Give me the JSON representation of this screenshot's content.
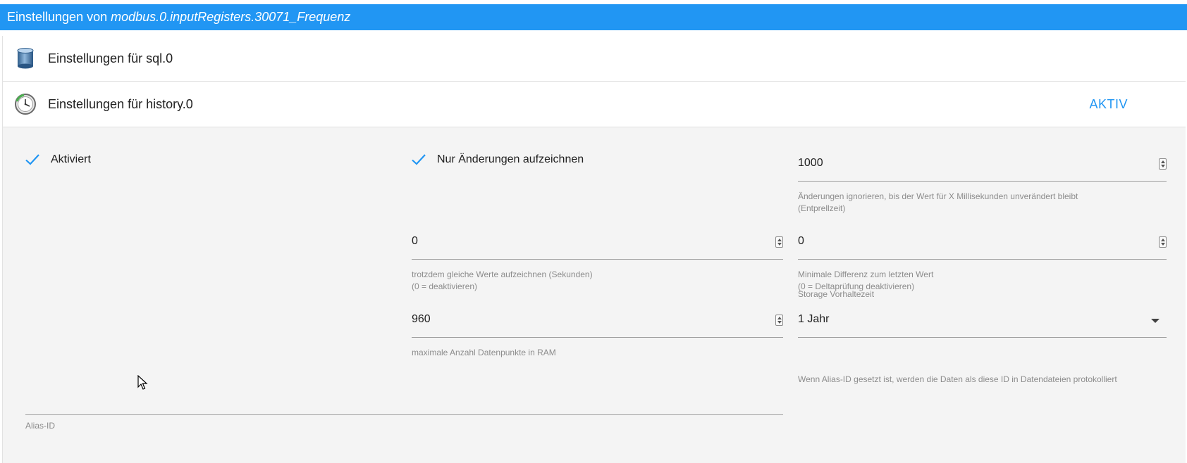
{
  "window": {
    "title_prefix": "Einstellungen von ",
    "object_id": "modbus.0.inputRegisters.30071_Frequenz"
  },
  "adapters": [
    {
      "label": "Einstellungen für sql.0",
      "icon": "database-icon",
      "status": ""
    },
    {
      "label": "Einstellungen für history.0",
      "icon": "clock-icon",
      "status": "AKTIV"
    }
  ],
  "settings": {
    "enabled": {
      "label": "Aktiviert",
      "checked": true
    },
    "changes_only": {
      "label": "Nur Änderungen aufzeichnen",
      "checked": true
    },
    "debounce": {
      "value": "1000",
      "helper": "Änderungen ignorieren, bis der Wert für X Millisekunden unverändert bleibt\n(Entprellzeit)"
    },
    "change_interval": {
      "value": "0",
      "helper": "trotzdem gleiche Werte aufzeichnen (Sekunden)\n(0 = deaktivieren)"
    },
    "min_difference": {
      "value": "0",
      "helper": "Minimale Differenz zum letzten Wert\n(0 = Deltaprüfung deaktivieren)"
    },
    "max_ram": {
      "value": "960",
      "helper": "maximale Anzahl Datenpunkte in RAM"
    },
    "retention": {
      "label": "Storage Vorhaltezeit",
      "selected": "1 Jahr"
    },
    "alias": {
      "value": "",
      "label": "Alias-ID",
      "helper": "Wenn Alias-ID gesetzt ist, werden die Daten als diese ID in Datendateien protokolliert"
    }
  },
  "colors": {
    "accent": "#2196f3",
    "details_bg": "#f4f4f4",
    "helper_text": "#8c8c8c"
  }
}
